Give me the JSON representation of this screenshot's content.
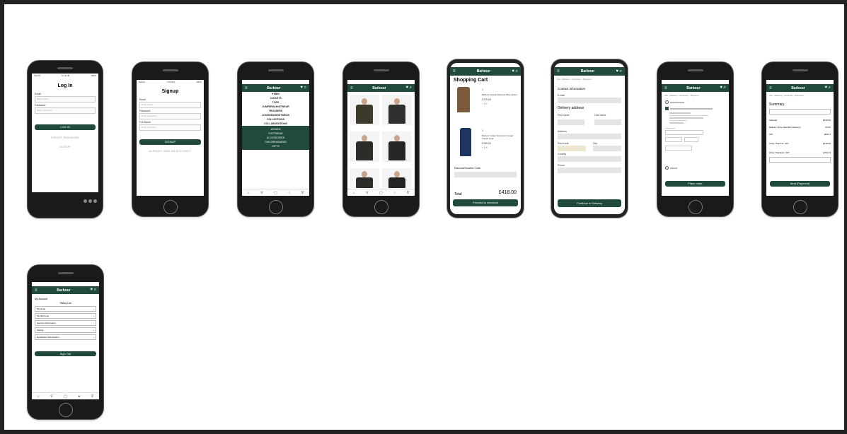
{
  "login": {
    "status_left": "Sketch",
    "status_time": "9:41 AM",
    "status_right": "100%",
    "title": "Log In",
    "email_label": "Email",
    "email_placeholder": "Enter email...",
    "password_label": "Password",
    "password_placeholder": "Enter password...",
    "login_button": "LOG IN",
    "forgot_link": "FORGOT PASSWORD",
    "signup_link": "SIGNUP"
  },
  "signup": {
    "status_left": "Sketch",
    "status_time": "7:52 PM",
    "status_right": "100%",
    "title": "Signup",
    "email_label": "Email",
    "email_placeholder": "Enter email...",
    "password_label": "Password",
    "password_placeholder": "Enter password...",
    "fullname_label": "Full Name",
    "fullname_placeholder": "Enter full name...",
    "signup_button": "SIGNUP",
    "have_account_link": "ALREADY HAVE AN ACCOUNT?"
  },
  "menu": {
    "brand": "Barbour",
    "section_label": "MEN",
    "items": [
      "JACKETS",
      "TOPS",
      "JUMPERS&KNITWEAR",
      "TROUSERS",
      "LOUNGE&NIGHTWEAR",
      "COLLECTIONS",
      "COLLABORATIONS"
    ],
    "dark_items": [
      "WOMEN",
      "FOOTWEAR",
      "ACCESSORIES",
      "CHILDRENSWEAR",
      "GIFTS"
    ]
  },
  "listing": {
    "brand": "Barbour"
  },
  "cart": {
    "brand": "Barbour",
    "title": "Shopping Cart",
    "items": [
      {
        "qty": "1",
        "name": "Barbour Classic Beaufort Wax Jacket",
        "price": "£229.00"
      },
      {
        "qty": "1",
        "name": "Barbour Grafer Somerset Casual Trench Coat",
        "price": "£189.00"
      }
    ],
    "discount_label": "Discount/Voucher Code",
    "total_label": "Total",
    "total_value": "£418.00",
    "checkout_button": "Process to checkout"
  },
  "contact": {
    "brand": "Barbour",
    "crumbs": [
      "Info",
      "Delivery",
      "Summary",
      "Payment"
    ],
    "contact_heading": "Contact information",
    "email_label": "E-mail",
    "delivery_heading": "Delivery address",
    "first_name_label": "First name",
    "last_name_label": "Last name",
    "address_label": "Address",
    "postcode_label": "Post code",
    "city_label": "City",
    "country_label": "Country",
    "phone_label": "Phone",
    "continue_button": "Continue to Delivery"
  },
  "delivery": {
    "brand": "Barbour",
    "crumbs": [
      "Info",
      "Delivery",
      "Summary",
      "Payment"
    ],
    "place_order_button": "Place order"
  },
  "summary": {
    "brand": "Barbour",
    "crumbs": [
      "Info",
      "Delivery",
      "Summary",
      "Payment"
    ],
    "heading": "Summary",
    "rows": [
      {
        "label": "Subtotal",
        "value": "£418.00"
      },
      {
        "label": "Delivery (Free Standard Delivery)",
        "value": "£0.00"
      },
      {
        "label": "VAT",
        "value": "£83.67"
      },
      {
        "label": "Order Total Incl. VAT",
        "value": "£418.00"
      },
      {
        "label": "Order Total Excl. VAT",
        "value": "£334.33"
      }
    ],
    "next_button": "Next (Payment)"
  },
  "account": {
    "brand": "Barbour",
    "heading": "My Account",
    "user": "Tiffany Lee",
    "rows": [
      "My Order",
      "My Wish List",
      "Account Information",
      "Setting",
      "Newsletter Subscription"
    ],
    "signout_button": "Sign Out"
  },
  "colors": {
    "brand_green": "#1f4a3d",
    "frame": "#222222"
  }
}
